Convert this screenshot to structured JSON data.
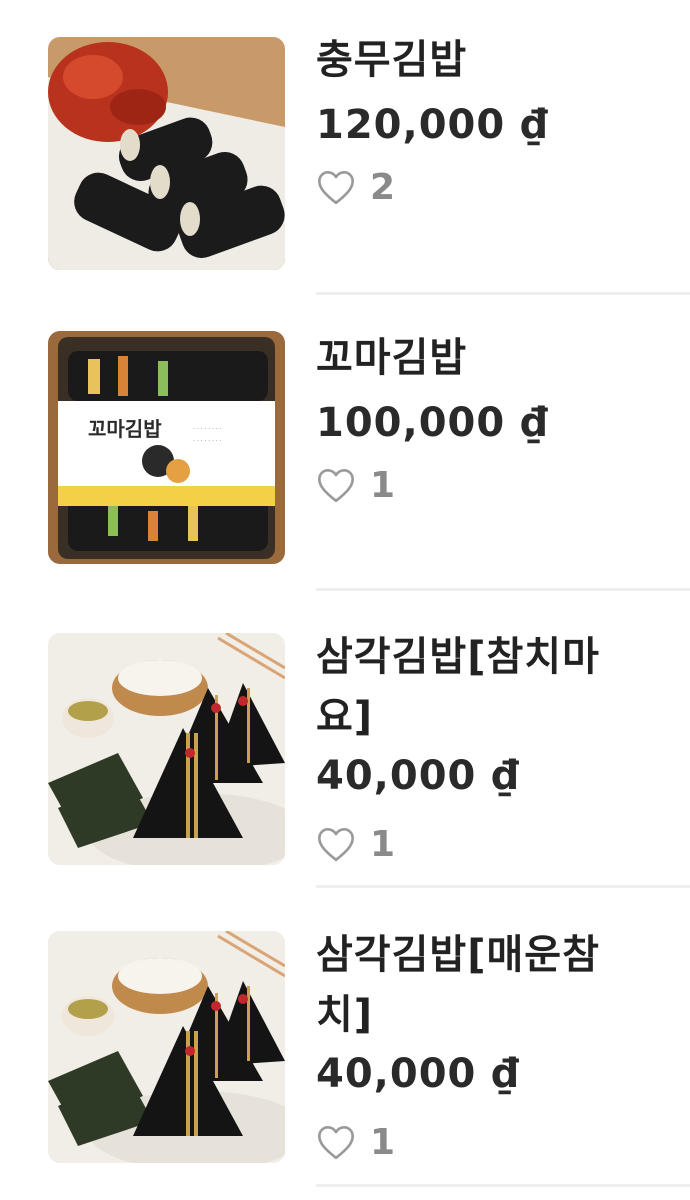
{
  "products": [
    {
      "name": "충무김밥",
      "price": "120,000 ₫",
      "likes": "2",
      "image": "chungmu-gimbap-photo"
    },
    {
      "name": "꼬마김밥",
      "price": "100,000 ₫",
      "likes": "1",
      "image": "kkoma-gimbap-box-photo",
      "package_label": "꼬마김밥"
    },
    {
      "name": "삼각김밥[참치마요]",
      "name_lines": [
        "삼각김밥[참치마",
        "요]"
      ],
      "price": "40,000 ₫",
      "likes": "1",
      "image": "triangle-gimbap-photo"
    },
    {
      "name": "삼각김밥[매운참치]",
      "name_lines": [
        "삼각김밥[매운참",
        "치]"
      ],
      "price": "40,000 ₫",
      "likes": "1",
      "image": "triangle-gimbap-photo"
    }
  ],
  "icons": {
    "like": "heart-outline-icon"
  },
  "colors": {
    "like_icon": "#9a9a9a",
    "like_count": "#8a8a8a",
    "divider": "#efefef"
  }
}
